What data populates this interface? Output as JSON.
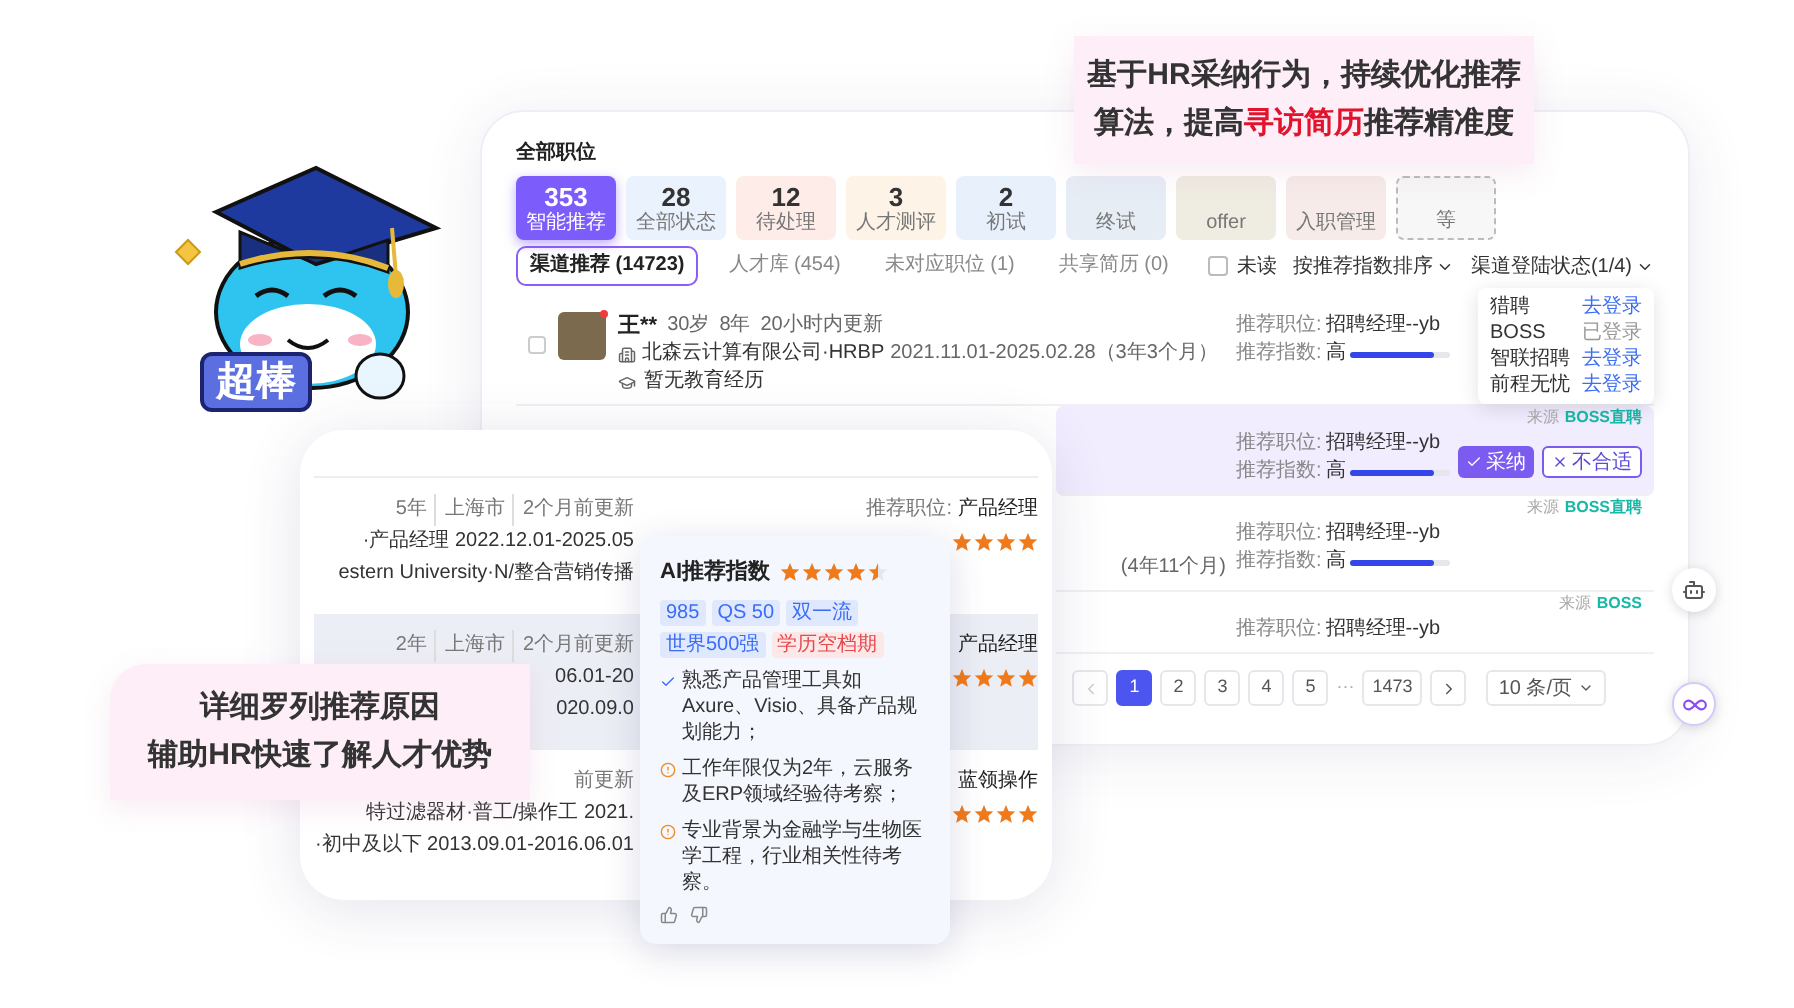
{
  "back_panel": {
    "title": "全部职位",
    "stat_tiles": [
      {
        "count": "353",
        "label": "智能推荐",
        "selected": true,
        "color": "#7c5cfa",
        "kind": "tile"
      },
      {
        "count": "28",
        "label": "全部状态",
        "selected": false,
        "color": "#eaf2fd",
        "kind": "tile"
      },
      {
        "count": "12",
        "label": "待处理",
        "selected": false,
        "color": "#fdece8",
        "kind": "tile"
      },
      {
        "count": "3",
        "label": "人才测评",
        "selected": false,
        "color": "#fdf3e6",
        "kind": "tile"
      },
      {
        "count": "2",
        "label": "初试",
        "selected": false,
        "color": "#e8f0fc",
        "kind": "tile"
      },
      {
        "label": "终试",
        "selected": false,
        "color": "#e6edf5",
        "kind": "tile"
      },
      {
        "label": "offer",
        "selected": false,
        "color": "#efece2",
        "kind": "tile"
      },
      {
        "label": "入职管理",
        "selected": false,
        "color": "#f6ebe8",
        "kind": "tile"
      },
      {
        "label": "等",
        "selected": false,
        "color": "#f7f7f7",
        "kind": "dashed"
      }
    ],
    "tabs": [
      {
        "label": "渠道推荐 (14723)",
        "selected": true
      },
      {
        "label": "人才库 (454)",
        "selected": false
      },
      {
        "label": "未对应职位 (1)",
        "selected": false
      },
      {
        "label": "共享简历 (0)",
        "selected": false
      }
    ],
    "unread_filter": {
      "label": "未读",
      "checked": false
    },
    "sort": "按推荐指数排序",
    "channel_status": "渠道登陆状态(1/4)",
    "channel_menu": [
      {
        "channel": "猎聘",
        "status": "去登录",
        "logged_in": false
      },
      {
        "channel": "BOSS",
        "status": "已登录",
        "logged_in": true
      },
      {
        "channel": "智联招聘",
        "status": "去登录",
        "logged_in": false
      },
      {
        "channel": "前程无忧",
        "status": "去登录",
        "logged_in": false
      }
    ],
    "candidates": [
      {
        "name": "王**",
        "age": "30岁",
        "experience": "8年",
        "updated": "20小时内更新",
        "company": "北森云计算有限公司·HRBP",
        "period": "2021.11.01-2025.02.28（3年3个月）",
        "education": "暂无教育经历",
        "unread": true,
        "checked": false,
        "highlighted": false,
        "position_label": "推荐职位:",
        "position": "招聘经理--yb",
        "index_label": "推荐指数:",
        "index_value": "高",
        "level": 0.85
      },
      {
        "highlighted": true,
        "source_label": "来源",
        "source": "BOSS直聘",
        "position_label": "推荐职位:",
        "position": "招聘经理--yb",
        "index_label": "推荐指数:",
        "index_value": "高",
        "level": 0.85,
        "actions": [
          {
            "label": "采纳",
            "kind": "primary"
          },
          {
            "label": "不合适",
            "kind": "outline"
          }
        ]
      },
      {
        "highlighted": false,
        "period": "(4年11个月)",
        "source_label": "来源",
        "source": "BOSS直聘",
        "position_label": "推荐职位:",
        "position": "招聘经理--yb",
        "index_label": "推荐指数:",
        "index_value": "高",
        "level": 0.85
      },
      {
        "highlighted": false,
        "source_label": "来源",
        "source": "BOSS",
        "position_label": "推荐职位:",
        "position": "招聘经理--yb"
      }
    ],
    "pagination": {
      "pages": [
        {
          "label": "1",
          "selected": true
        },
        {
          "label": "2",
          "selected": false
        },
        {
          "label": "3",
          "selected": false
        },
        {
          "label": "4",
          "selected": false
        },
        {
          "label": "5",
          "selected": false
        }
      ],
      "ellipsis": "···",
      "last_page": "1473",
      "page_size": "10 条/页"
    }
  },
  "front_card": {
    "rows": [
      {
        "meta": [
          "5年",
          "上海市",
          "2个月前更新"
        ],
        "lines": [
          "·产品经理 2022.12.01-2025.05",
          "estern University·N/整合营销传播"
        ],
        "position_label": "推荐职位:",
        "position": "产品经理",
        "stars": 4,
        "highlighted": false
      },
      {
        "meta": [
          "2年",
          "上海市",
          "2个月前更新"
        ],
        "lines": [
          "06.01-20",
          "020.09.0"
        ],
        "position": "产品经理",
        "stars": 4,
        "highlighted": true
      },
      {
        "meta": [
          "前更新"
        ],
        "lines": [
          "特过滤器材·普工/操作工 2021.",
          "·初中及以下 2013.09.01-2016.06.01"
        ],
        "position": "蓝领操作",
        "stars": 4,
        "highlighted": false
      }
    ]
  },
  "ai_popup": {
    "title": "AI推荐指数",
    "stars": 4.5,
    "tags": [
      {
        "label": "985",
        "kind": "info"
      },
      {
        "label": "QS 50",
        "kind": "info"
      },
      {
        "label": "双一流",
        "kind": "info"
      },
      {
        "label": "世界500强",
        "kind": "info"
      },
      {
        "label": "学历空档期",
        "kind": "risk"
      }
    ],
    "reasons": [
      {
        "text": "熟悉产品管理工具如Axure、Visio、具备产品规划能力；",
        "kind": "match"
      },
      {
        "text": "工作年限仅为2年，云服务及ERP领域经验待考察；",
        "kind": "warning"
      },
      {
        "text": "专业背景为金融学与生物医学工程，行业相关性待考察。",
        "kind": "warning"
      }
    ]
  },
  "top_callout": {
    "lines": [
      [
        {
          "text": "基于HR采纳行为，持续优化推荐",
          "highlight": false
        }
      ],
      [
        {
          "text": "算法，提高",
          "highlight": false
        },
        {
          "text": "寻访简历",
          "highlight": true
        },
        {
          "text": "推荐精准度",
          "highlight": false
        }
      ]
    ]
  },
  "bottom_callout": {
    "lines": [
      "详细罗列推荐原因",
      "辅助HR快速了解人才优势"
    ]
  },
  "mascot": {
    "badge": "超棒"
  }
}
